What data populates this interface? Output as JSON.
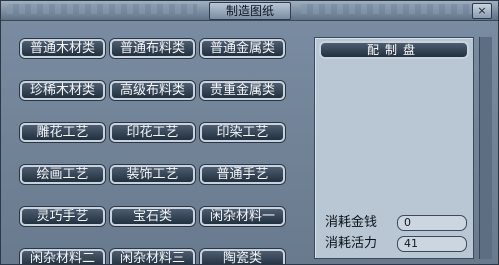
{
  "window": {
    "title": "制造图纸",
    "close_icon": "×"
  },
  "buttons": [
    "普通木材类",
    "普通布料类",
    "普通金属类",
    "珍稀木材类",
    "高级布料类",
    "贵重金属类",
    "雕花工艺",
    "印花工艺",
    "印染工艺",
    "绘画工艺",
    "装饰工艺",
    "普通手艺",
    "灵巧手艺",
    "宝石类",
    "闲杂材料一",
    "闲杂材料二",
    "闲杂材料三",
    "陶瓷类"
  ],
  "panel": {
    "title": "配制盘",
    "cost_money_label": "消耗金钱",
    "cost_money_value": "0",
    "cost_energy_label": "消耗活力",
    "cost_energy_value": "41"
  }
}
